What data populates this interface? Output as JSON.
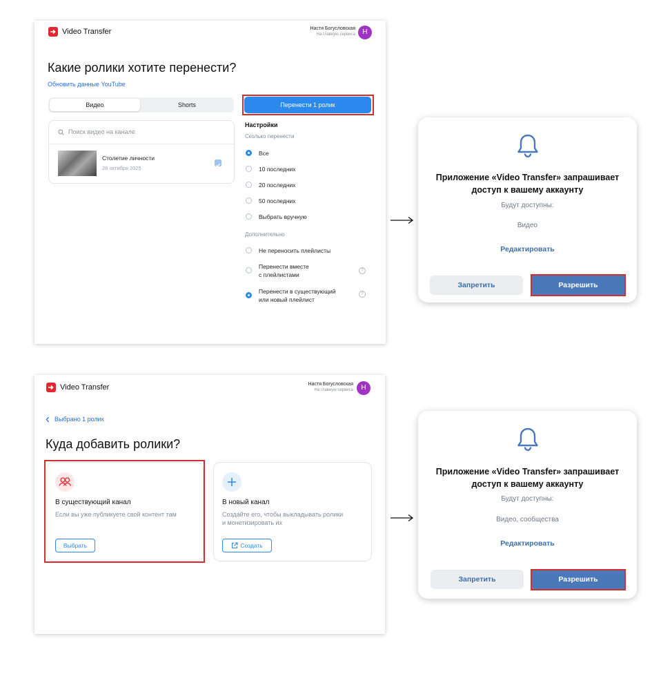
{
  "panel1": {
    "app_name": "Video Transfer",
    "user_name": "Настя Богусловская",
    "user_sub": "На главную сервиса",
    "avatar_letter": "Н",
    "title": "Какие ролики хотите перенести?",
    "refresh_link": "Обновить данные YouTube",
    "tabs": [
      "Видео",
      "Shorts"
    ],
    "transfer_button": "Перенести 1 ролик",
    "search_placeholder": "Поиск видео на канале",
    "video": {
      "title": "Столетие личности",
      "date": "28 октября 2025"
    },
    "settings_title": "Настройки",
    "how_many_label": "Сколько перенести",
    "how_many_options": [
      "Все",
      "10 последних",
      "20 последних",
      "50 последних",
      "Выбрать вручную"
    ],
    "extra_label": "Дополнительно",
    "extra_options": [
      "Не переносить плейлисты",
      "Перенести вместе",
      "с плейлистами",
      "Перенести в существующий",
      "или новый плейлист"
    ]
  },
  "dialog1": {
    "title_line1": "Приложение «Video Transfer» запрашивает",
    "title_line2": "доступ к вашему аккаунту",
    "available_label": "Будут доступны:",
    "available_value": "Видео",
    "edit_link": "Редактировать",
    "deny_button": "Запретить",
    "allow_button": "Разрешить"
  },
  "panel2": {
    "app_name": "Video Transfer",
    "user_name": "Настя Богусловская",
    "user_sub": "На главную сервиса",
    "avatar_letter": "Н",
    "back_link": "Выбрано 1 ролик",
    "title": "Куда добавить ролики?",
    "existing_title": "В существующий канал",
    "existing_desc": "Если вы уже публикуете свой контент там",
    "existing_button": "Выбрать",
    "new_title": "В новый канал",
    "new_desc_line1": "Создайте его, чтобы выкладывать ролики",
    "new_desc_line2": "и монетизировать их",
    "new_button": "Создать"
  },
  "dialog2": {
    "title_line1": "Приложение «Video Transfer» запрашивает",
    "title_line2": "доступ к вашему аккаунту",
    "available_label": "Будут доступны:",
    "available_value": "Видео, сообщества",
    "edit_link": "Редактировать",
    "deny_button": "Запретить",
    "allow_button": "Разрешить"
  },
  "colors": {
    "accent_blue": "#2b88ec",
    "vk_blue": "#4a78b8",
    "highlight_red": "#d32d30",
    "logo_red": "#e3262f",
    "avatar_purple": "#9f33c4"
  },
  "icons": [
    "logo-icon",
    "search-icon",
    "checkbox-checked-icon",
    "help-icon",
    "bell-icon",
    "arrow-right-icon",
    "chevron-left-icon",
    "people-icon",
    "plus-icon",
    "external-link-icon"
  ]
}
